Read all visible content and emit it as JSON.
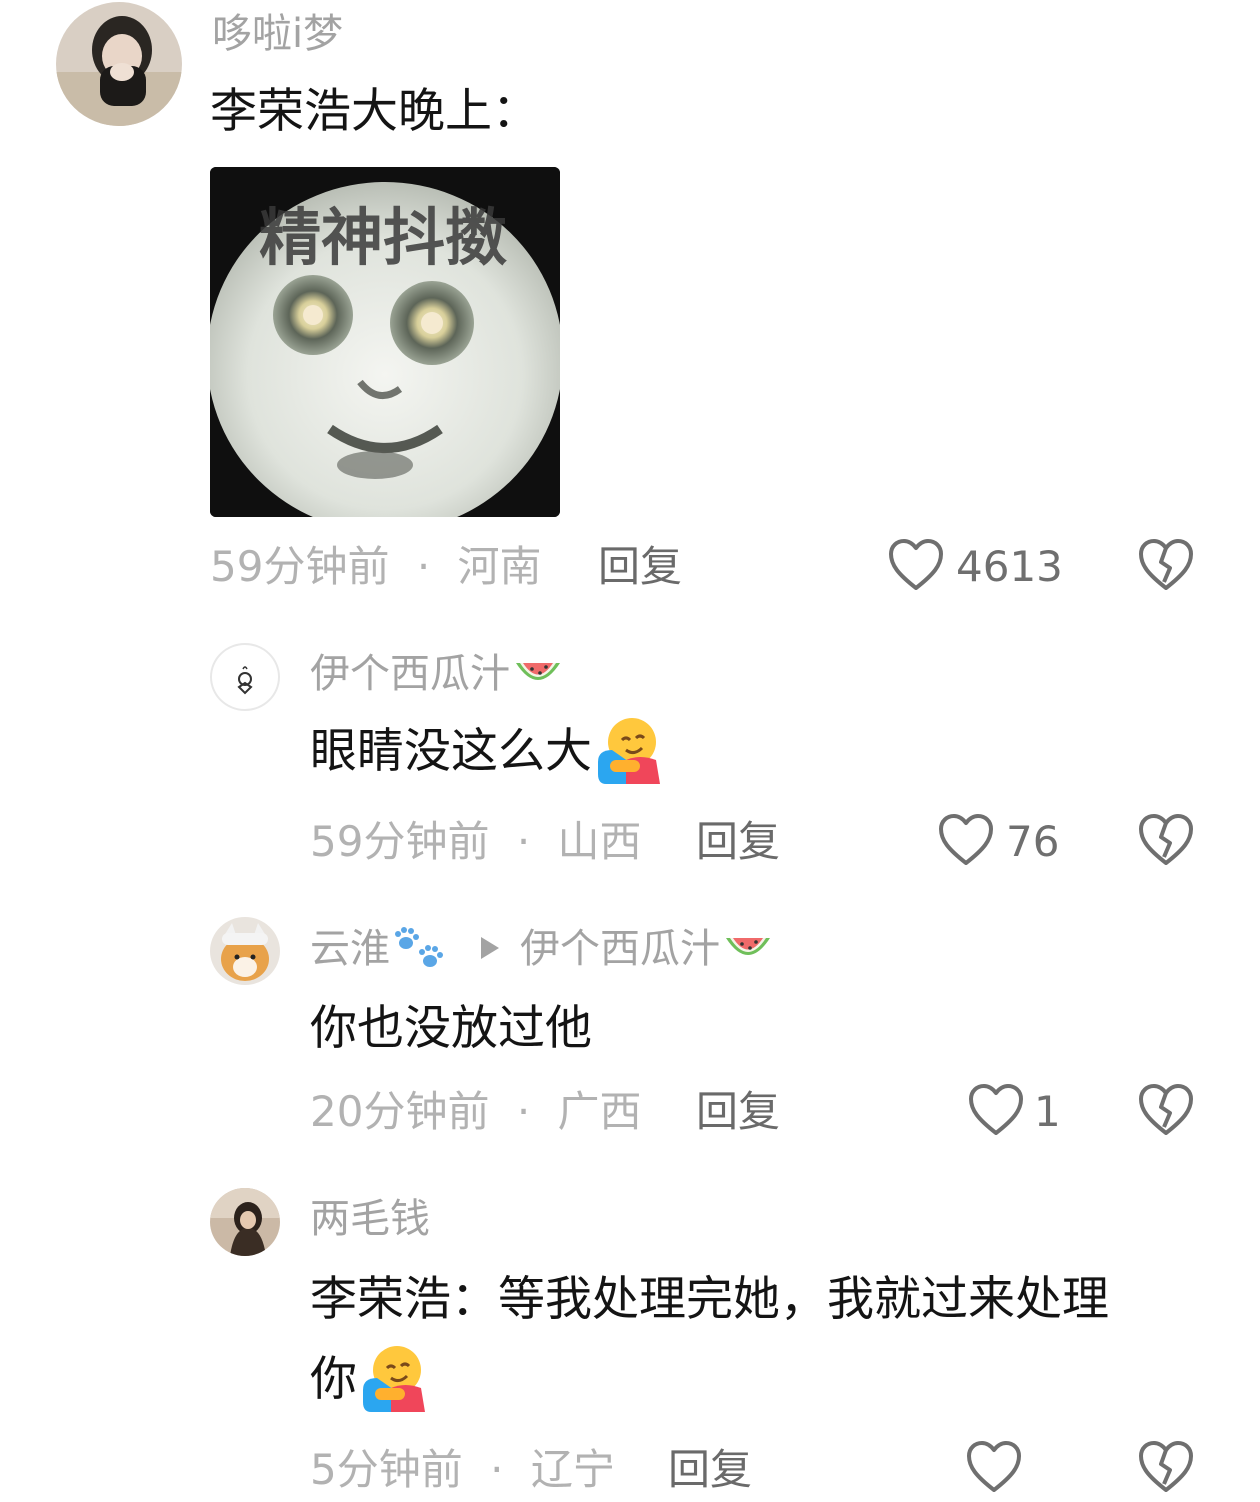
{
  "comments": [
    {
      "username": "哆啦i梦",
      "text": "李荣浩大晚上：",
      "sticker_text": "精神抖擞",
      "time": "59分钟前",
      "sep": "·",
      "location": "河南",
      "reply_label": "回复",
      "likes": "4613"
    },
    {
      "username": "伊个西瓜汁",
      "username_emoji": "watermelon-emoji",
      "text": "眼睛没这么大",
      "text_emoji": "hugging-face-emoji",
      "time": "59分钟前",
      "sep": "·",
      "location": "山西",
      "reply_label": "回复",
      "likes": "76"
    },
    {
      "username": "云淮",
      "username_emoji": "paw-prints-emoji",
      "reply_to": "伊个西瓜汁",
      "reply_to_emoji": "watermelon-emoji",
      "text": "你也没放过他",
      "time": "20分钟前",
      "sep": "·",
      "location": "广西",
      "reply_label": "回复",
      "likes": "1"
    },
    {
      "username": "两毛钱",
      "text_line1": "李荣浩：等我处理完她，我就过来处理",
      "text_line2": "你",
      "text_emoji": "hugging-face-emoji",
      "time": "5分钟前",
      "sep": "·",
      "location": "辽宁",
      "reply_label": "回复"
    }
  ],
  "colors": {
    "username": "#a3a3a3",
    "content": "#141414",
    "meta": "#b2b2b2",
    "reply": "#6a6a6a",
    "icon": "#6f6f6f"
  }
}
